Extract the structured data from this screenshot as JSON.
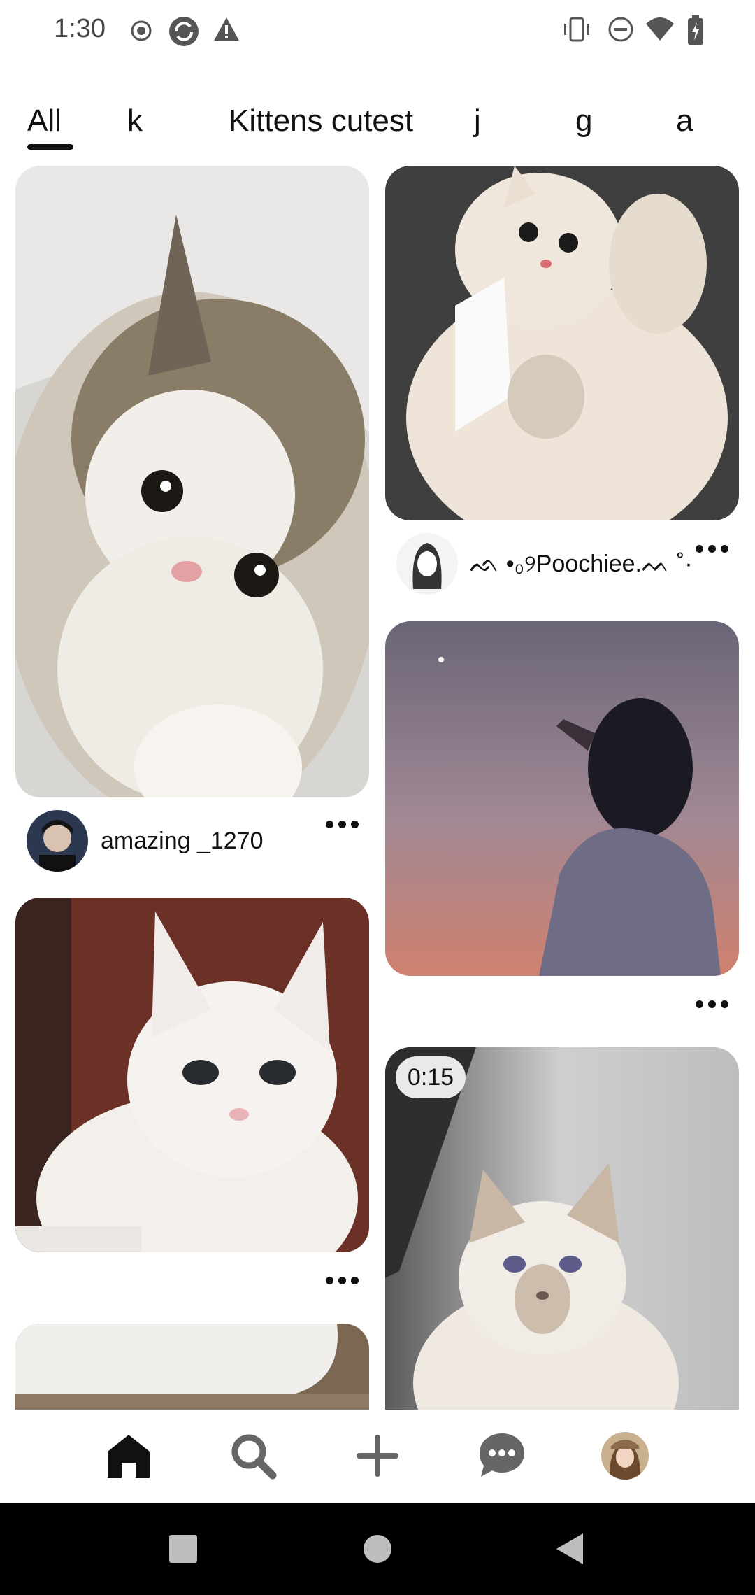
{
  "status_bar": {
    "time": "1:30",
    "left_icons": [
      "record-icon",
      "sync-icon",
      "warning-icon"
    ],
    "right_icons": [
      "vibrate-icon",
      "do-not-disturb-icon",
      "wifi-icon",
      "battery-charging-icon"
    ]
  },
  "tabs": [
    {
      "label": "All",
      "selected": true
    },
    {
      "label": "k",
      "selected": false
    },
    {
      "label": "Kittens cutest",
      "selected": false
    },
    {
      "label": "j",
      "selected": false
    },
    {
      "label": "g",
      "selected": false
    },
    {
      "label": "a",
      "selected": false
    }
  ],
  "pins": {
    "left": [
      {
        "description": "tabby kitten reaching up",
        "username": "amazing _1270"
      },
      {
        "description": "white cat on brown background",
        "username": ""
      },
      {
        "description": "partially visible pin",
        "username": ""
      }
    ],
    "right": [
      {
        "description": "fluffy cream kitten",
        "username": "ᨒ •₀୨Poochiee.ᨓ ˚·"
      },
      {
        "description": "girl silhouette against sunset sky",
        "username": ""
      },
      {
        "description": "birman cat video",
        "username": "",
        "duration": "0:15"
      }
    ]
  },
  "bottom_nav": {
    "items": [
      "home-icon",
      "search-icon",
      "create-icon",
      "messages-icon",
      "profile-avatar"
    ],
    "active": "home"
  },
  "system_nav": [
    "recents-icon",
    "home-button-icon",
    "back-icon"
  ],
  "colors": {
    "accent": "#111111",
    "background": "#ffffff",
    "badge": "#e9e9e9"
  }
}
